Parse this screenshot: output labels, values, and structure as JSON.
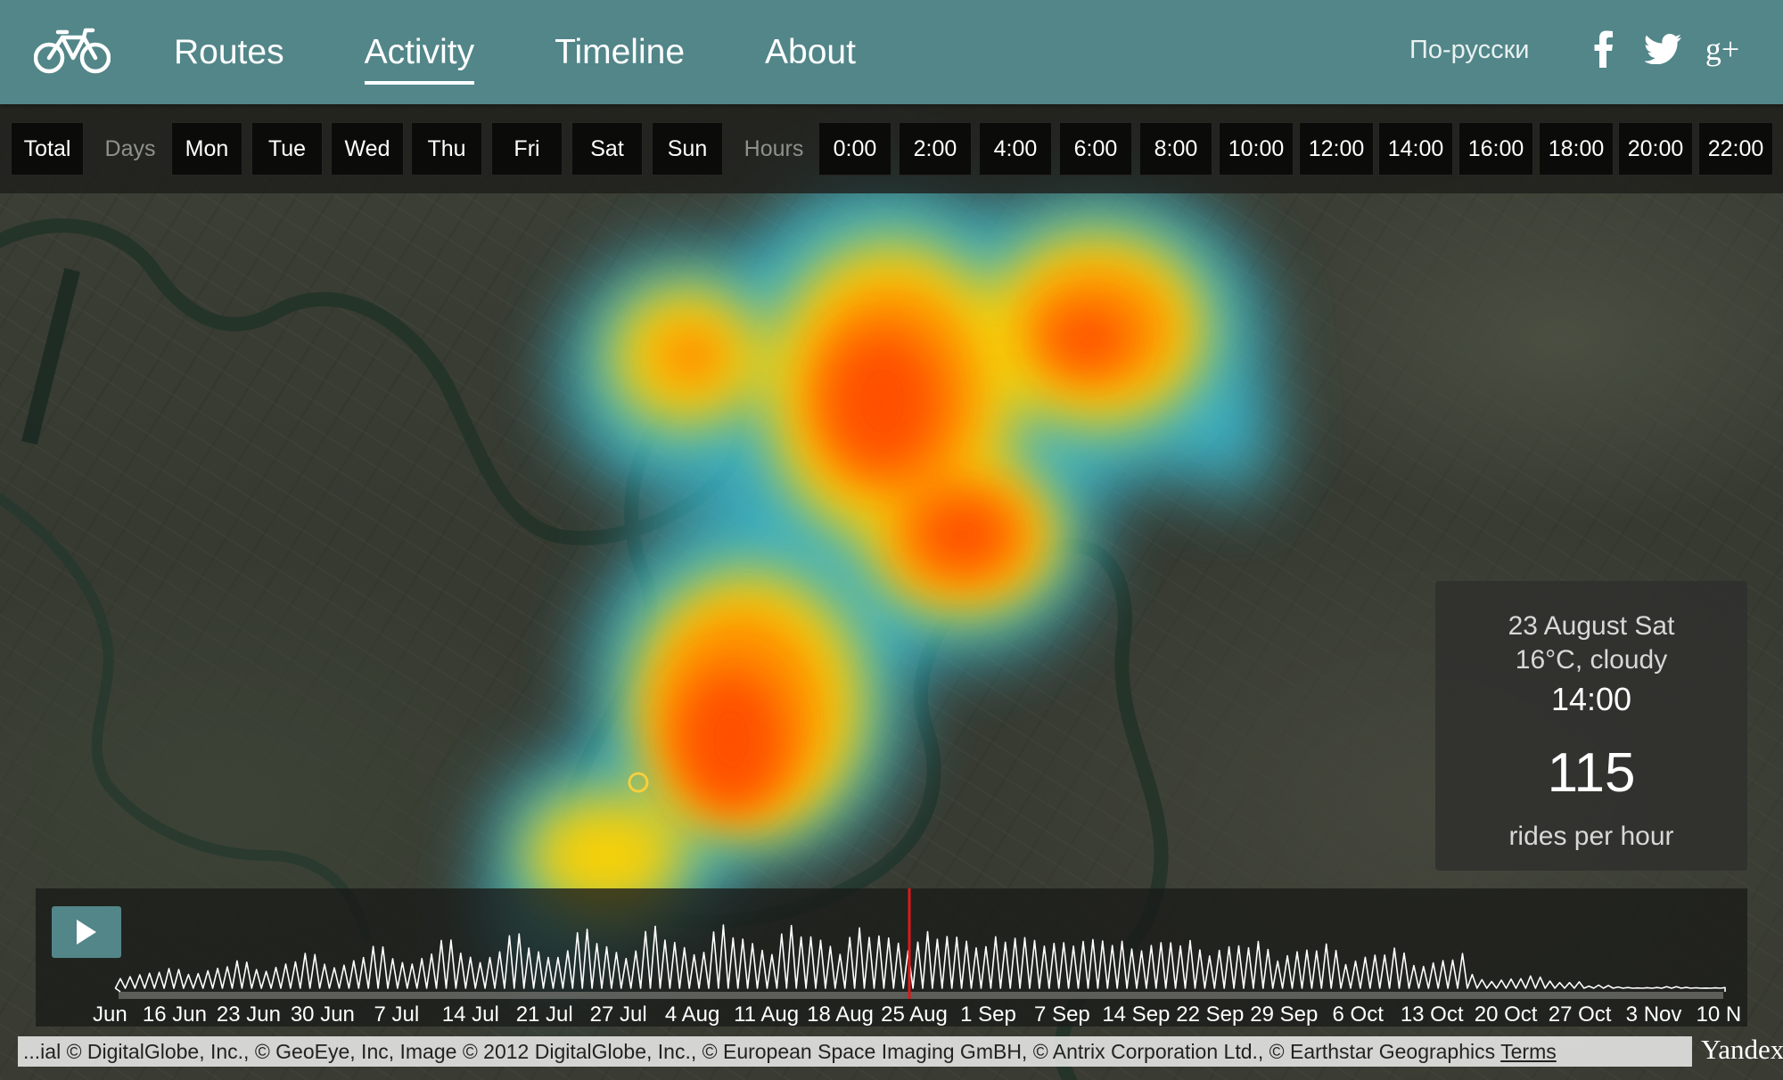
{
  "header": {
    "nav": [
      {
        "label": "Routes",
        "active": false
      },
      {
        "label": "Activity",
        "active": true
      },
      {
        "label": "Timeline",
        "active": false
      },
      {
        "label": "About",
        "active": false
      }
    ],
    "lang_label": "По-русски",
    "social": [
      "facebook-icon",
      "twitter-icon",
      "google-plus-icon"
    ],
    "google_plus_text": "g+"
  },
  "filters": {
    "total": "Total",
    "days_label": "Days",
    "days": [
      "Mon",
      "Tue",
      "Wed",
      "Thu",
      "Fri",
      "Sat",
      "Sun"
    ],
    "hours_label": "Hours",
    "hours": [
      "0:00",
      "2:00",
      "4:00",
      "6:00",
      "8:00",
      "10:00",
      "12:00",
      "14:00",
      "16:00",
      "18:00",
      "20:00",
      "22:00"
    ]
  },
  "info": {
    "date": "23 August Sat",
    "weather": "16°C, cloudy",
    "time": "14:00",
    "count": "115",
    "unit": "rides per hour"
  },
  "timeline": {
    "labels": [
      "Jun",
      "16 Jun",
      "23 Jun",
      "30 Jun",
      "7 Jul",
      "14 Jul",
      "21 Jul",
      "27 Jul",
      "4 Aug",
      "11 Aug",
      "18 Aug",
      "25 Aug",
      "1 Sep",
      "7 Sep",
      "14 Sep",
      "22 Sep",
      "29 Sep",
      "6 Oct",
      "13 Oct",
      "20 Oct",
      "27 Oct",
      "3 Nov",
      "10 N"
    ],
    "current_index": 11,
    "accent_color": "#e0181b"
  },
  "attribution": {
    "text": "...ial © DigitalGlobe, Inc., © GeoEye, Inc, Image © 2012 DigitalGlobe, Inc., © European Space Imaging GmBH, © Antrix Corporation Ltd., © Earthstar Geographics",
    "terms": "Terms",
    "logo": "Yandex"
  },
  "colors": {
    "header_bg": "#528689",
    "heat_hot": "#ff4a00",
    "heat_warm": "#ffd200",
    "heat_cool": "#3ec6dd"
  }
}
